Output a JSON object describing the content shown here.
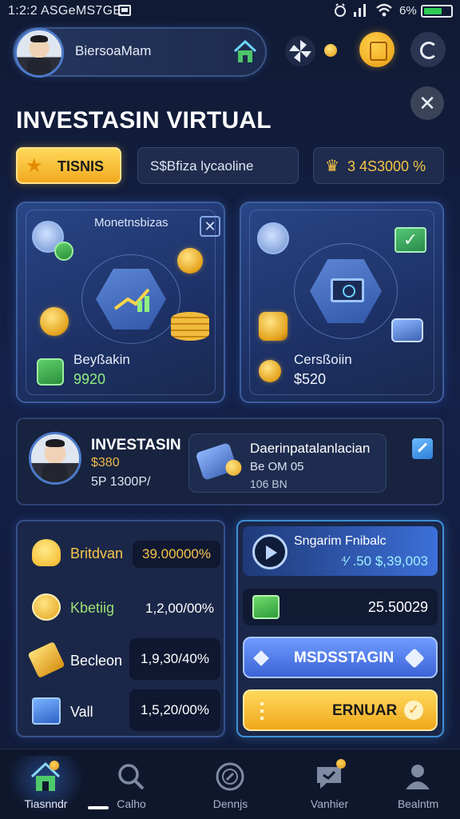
{
  "status_bar": {
    "time": "1:2:2 ASGeMS7GE",
    "battery_pct": "6%",
    "battery_level": 0.7
  },
  "header": {
    "profile_name": "BiersoaMam",
    "icons": [
      "home-icon",
      "pinwheel-icon",
      "coin-icon",
      "wallet-icon",
      "refresh-icon"
    ]
  },
  "page": {
    "title": "INVESTASIN VIRTUAL",
    "close_label": "✕"
  },
  "tabs": {
    "gold_label": "TISNIS",
    "search_label": "S$Bfiza lycaoline",
    "balance_label": "3 4S3000 %",
    "balance_icon": "♛"
  },
  "cards": {
    "left": {
      "head_label": "Monetnsbizas",
      "close_label": "✕",
      "label": "Beyßakin",
      "value": "9920"
    },
    "right": {
      "label": "Cersßoiin",
      "value": "$520",
      "check": "✓"
    }
  },
  "investor": {
    "name": "INVESTASIN",
    "amount": "$380",
    "sub": "5P 1300Р/",
    "deal": {
      "title": "Daerinpatalanlacian",
      "line2": "Be OM 05",
      "line3": "106 BN"
    }
  },
  "stats": [
    {
      "label": "Britdvan",
      "value": "39.00000%"
    },
    {
      "label": "Kbetiig",
      "value": "1,2,00/00%"
    },
    {
      "label": "Becleon",
      "value": "1,9,30/40%"
    },
    {
      "label": "Vall",
      "value": "1,5,20/00%"
    }
  ],
  "panel": {
    "title": "Sngarim Fnibalc",
    "amount": "⁴⁄ .50 $,39,003",
    "mid_value": "25.50029",
    "blue_button": "MSDSSTAGIN",
    "gold_button": "ERNUAR",
    "gold_check": "✓"
  },
  "bottom_nav": [
    {
      "label": "Tiasnndr",
      "icon": "home-icon"
    },
    {
      "label": "Calho",
      "icon": "search-icon"
    },
    {
      "label": "Dennjs",
      "icon": "compass-icon"
    },
    {
      "label": "Vanhier",
      "icon": "chat-icon"
    },
    {
      "label": "Bealntm",
      "icon": "profile-icon"
    }
  ],
  "colors": {
    "background": "#111b38",
    "accent_gold": "#f2a91f",
    "accent_blue": "#3b63d6",
    "accent_green": "#8ef07f"
  }
}
